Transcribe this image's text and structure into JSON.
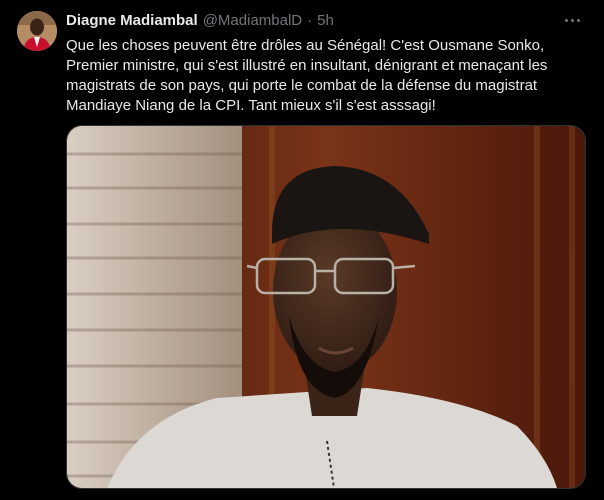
{
  "tweet": {
    "author_name": "Diagne Madiambal",
    "author_handle": "@MadiambalD",
    "separator": "·",
    "time": "5h",
    "text_lines": [
      "Que les choses peuvent être drôles au Sénégal! C'est Ousmane Sonko,",
      "Premier ministre, qui s'est illustré en insultant, dénigrant et menaçant les",
      "magistrats de son pays, qui porte le combat de la défense du magistrat",
      "Mandiaye Niang de la CPI. Tant mieux s'il s'est asssagi!"
    ]
  },
  "icons": {
    "more": "more-horizontal-icon",
    "avatar": "profile-avatar"
  },
  "colors": {
    "background": "#000000",
    "text_primary": "#e7e9ea",
    "text_secondary": "#71767b",
    "border": "#2f3336"
  }
}
